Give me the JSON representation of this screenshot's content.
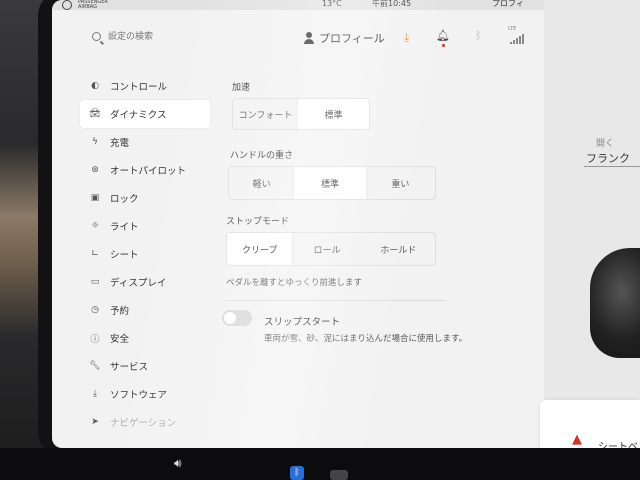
{
  "status_bar": {
    "airbag_label_1": "PASSENGER",
    "airbag_label_2": "AIRBAG",
    "temperature": "13°C",
    "time": "午前10:45",
    "profile": "プロフィ"
  },
  "top_bar": {
    "search_placeholder": "設定の検索",
    "profile_label": "プロフィール",
    "lte_label": "LTE"
  },
  "sidebar": {
    "items": [
      {
        "label": "コントロール",
        "icon": "toggle-icon"
      },
      {
        "label": "ダイナミクス",
        "icon": "car-icon"
      },
      {
        "label": "充電",
        "icon": "bolt-icon"
      },
      {
        "label": "オートパイロット",
        "icon": "steering-wheel-icon"
      },
      {
        "label": "ロック",
        "icon": "lock-icon"
      },
      {
        "label": "ライト",
        "icon": "sun-icon"
      },
      {
        "label": "シート",
        "icon": "seat-icon"
      },
      {
        "label": "ディスプレイ",
        "icon": "display-icon"
      },
      {
        "label": "予約",
        "icon": "clock-icon"
      },
      {
        "label": "安全",
        "icon": "info-icon"
      },
      {
        "label": "サービス",
        "icon": "wrench-icon"
      },
      {
        "label": "ソフトウェア",
        "icon": "download-icon"
      },
      {
        "label": "ナビゲーション",
        "icon": "navigation-icon"
      }
    ]
  },
  "dynamics": {
    "acceleration": {
      "label": "加速",
      "options": [
        "コンフォート",
        "標準"
      ],
      "selected": "標準"
    },
    "steering": {
      "label": "ハンドルの重さ",
      "options": [
        "軽い",
        "標準",
        "重い"
      ],
      "selected": "標準"
    },
    "stopping_mode": {
      "label": "ストップモード",
      "options": [
        "クリープ",
        "ロール",
        "ホールド"
      ],
      "selected": "クリープ",
      "description": "ペダルを離すとゆっくり前進します"
    },
    "slip_start": {
      "title": "スリップスタート",
      "description": "車両が雪、砂、泥にはまり込んだ場合に使用します。",
      "enabled": false
    }
  },
  "right_panel": {
    "frunk_open": "開く",
    "frunk_label": "フランク",
    "alert_text": "シートベ"
  },
  "colors": {
    "alert_red": "#d0342c",
    "download_orange": "#e08a2a",
    "bluetooth_blue": "#2a6fd6"
  }
}
